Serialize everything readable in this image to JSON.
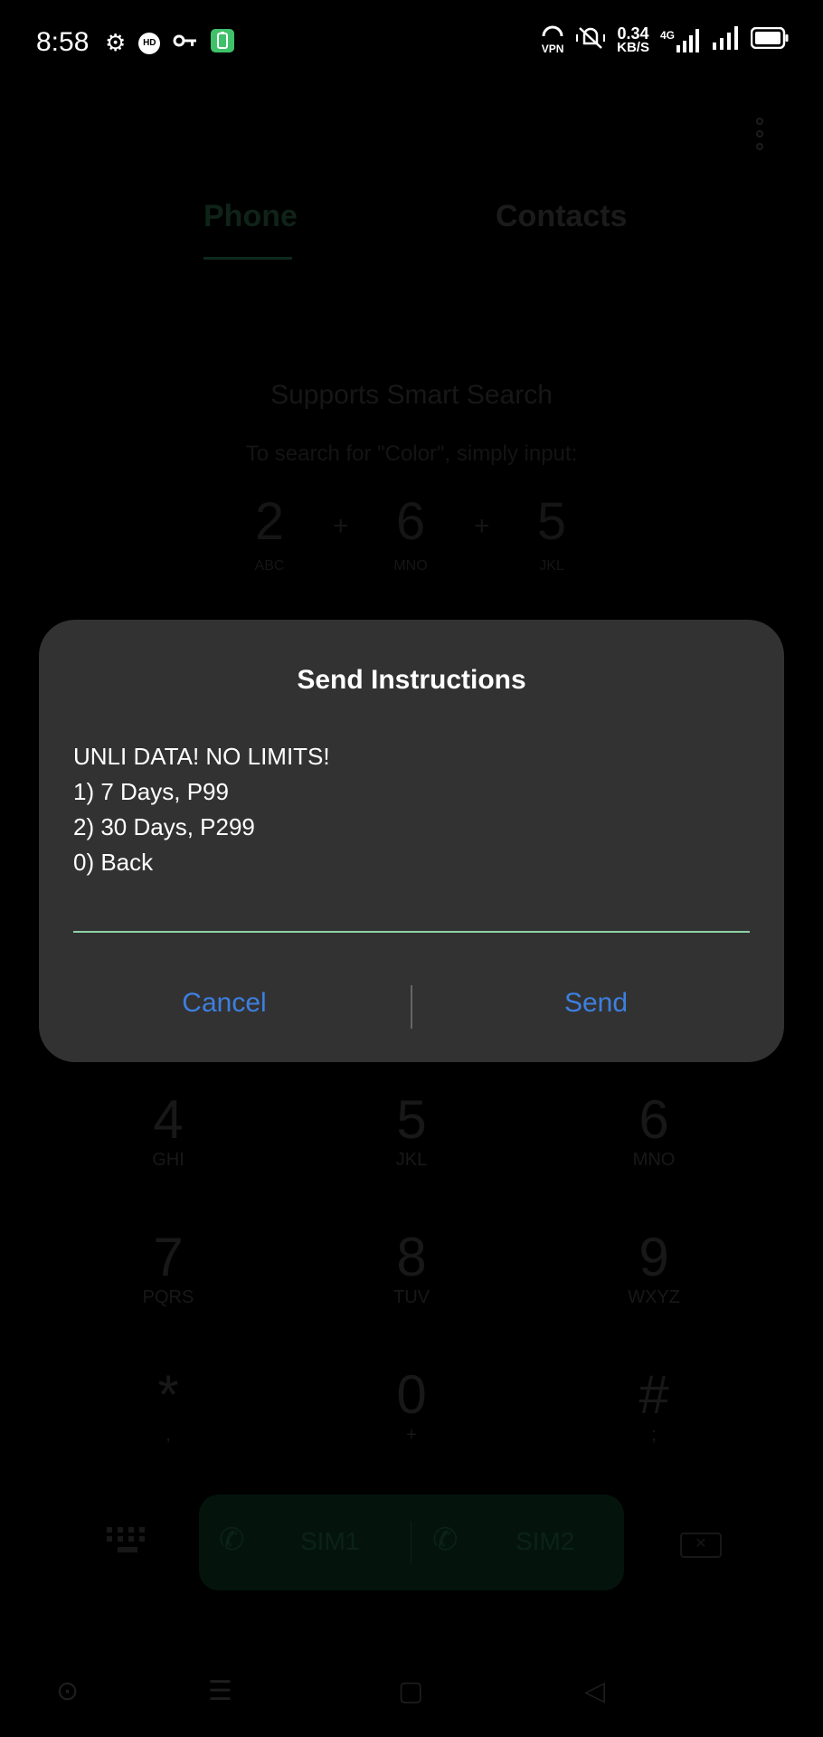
{
  "status_bar": {
    "time": "8:58",
    "net_speed_value": "0.34",
    "net_speed_unit": "KB/S",
    "vpn_label": "VPN",
    "network_type": "4G",
    "hd_label": "HD"
  },
  "tabs": {
    "phone": "Phone",
    "contacts": "Contacts"
  },
  "smart_search": {
    "title": "Supports Smart Search",
    "subtitle": "To search for \"Color\", simply input:",
    "keys": [
      {
        "digit": "2",
        "letters": "ABC"
      },
      {
        "digit": "6",
        "letters": "MNO"
      },
      {
        "digit": "5",
        "letters": "JKL"
      }
    ],
    "plus": "+"
  },
  "keypad": {
    "rows": [
      [
        {
          "digit": "4",
          "letters": "GHI"
        },
        {
          "digit": "5",
          "letters": "JKL"
        },
        {
          "digit": "6",
          "letters": "MNO"
        }
      ],
      [
        {
          "digit": "7",
          "letters": "PQRS"
        },
        {
          "digit": "8",
          "letters": "TUV"
        },
        {
          "digit": "9",
          "letters": "WXYZ"
        }
      ],
      [
        {
          "digit": "*",
          "letters": ","
        },
        {
          "digit": "0",
          "letters": "+"
        },
        {
          "digit": "#",
          "letters": ";"
        }
      ]
    ]
  },
  "call_bar": {
    "sim1": "SIM1",
    "sim2": "SIM2"
  },
  "dialog": {
    "title": "Send Instructions",
    "message_lines": [
      "UNLI DATA! NO LIMITS!",
      "1) 7 Days, P99",
      "2) 30 Days, P299",
      "0) Back"
    ],
    "input_value": "",
    "cancel_label": "Cancel",
    "send_label": "Send"
  },
  "colors": {
    "dialog_bg": "#323232",
    "button_text": "#3d7fe0",
    "input_underline": "#8fd1a6",
    "scrim": "#000000"
  }
}
